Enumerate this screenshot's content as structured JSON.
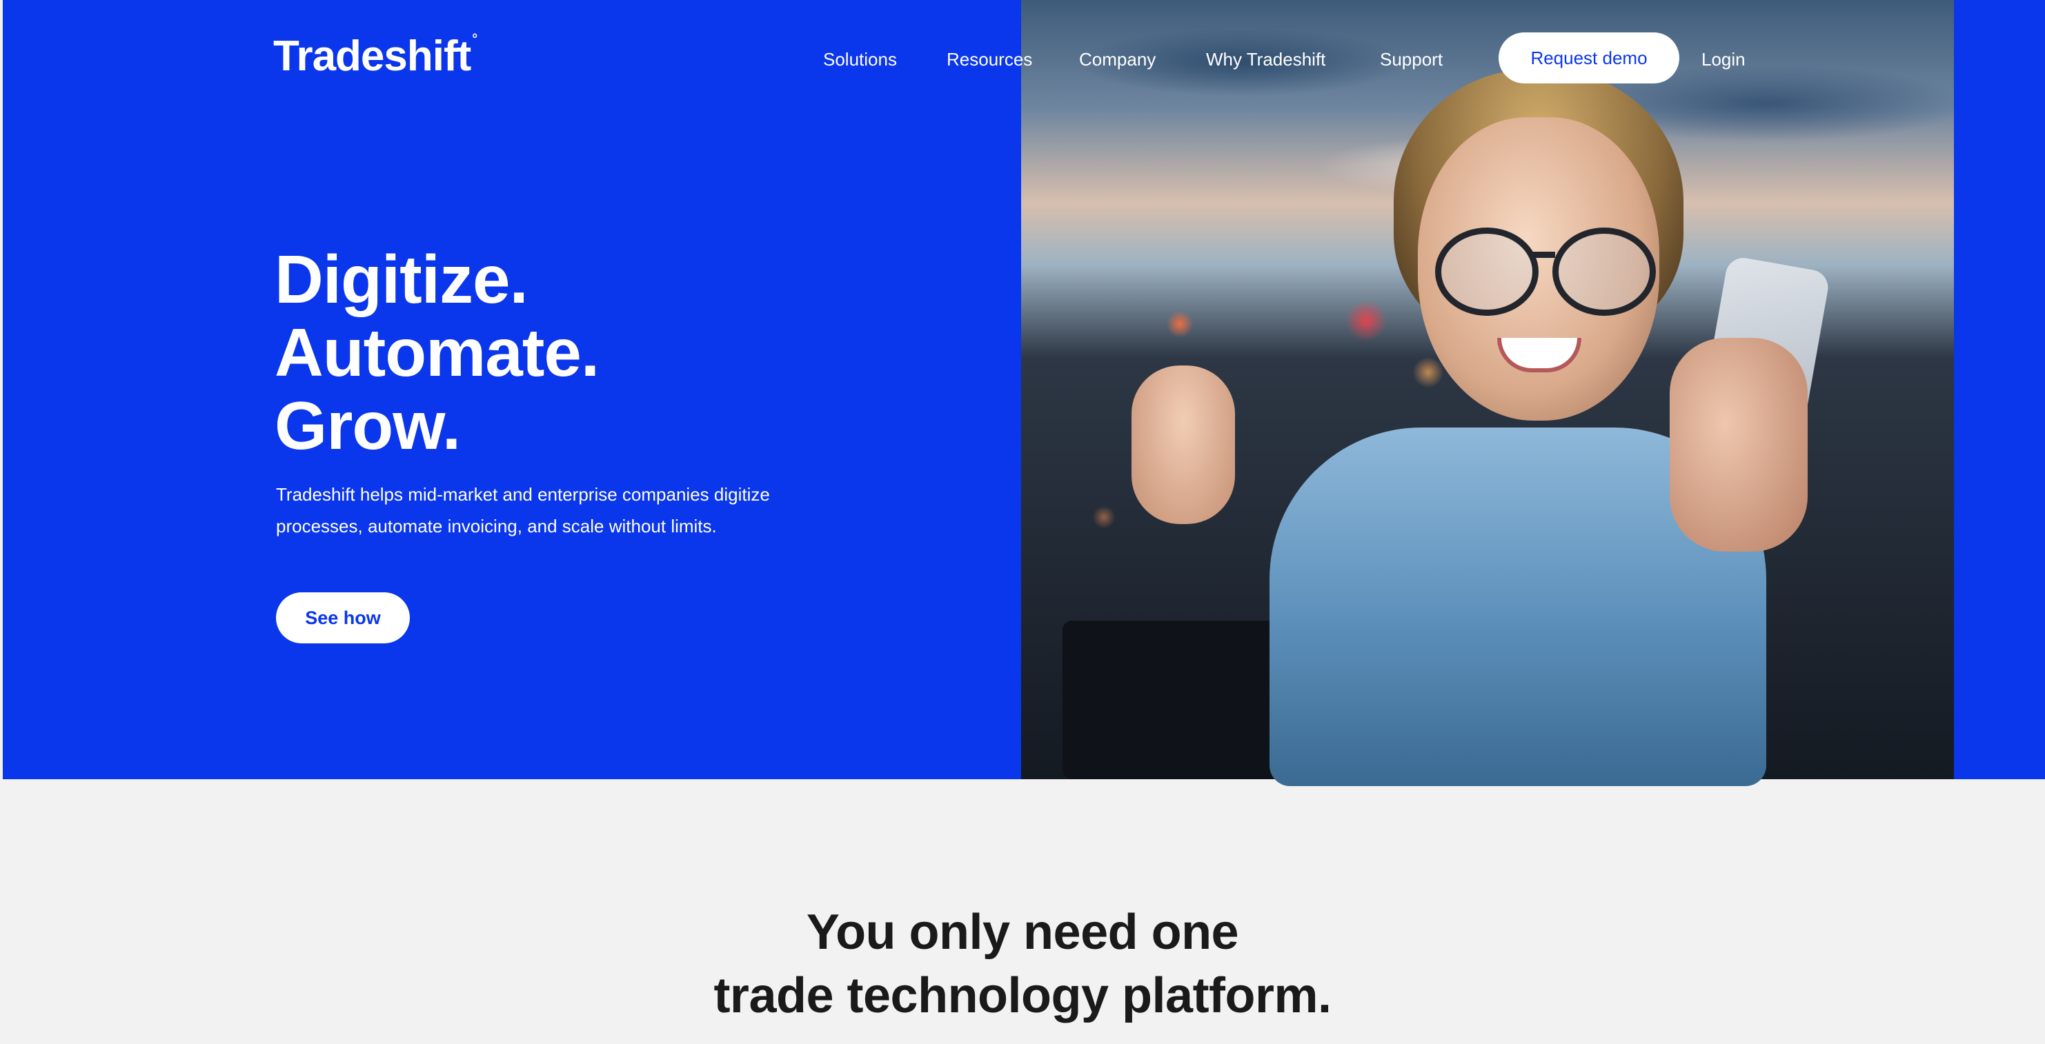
{
  "brand": {
    "name": "Tradeshift",
    "mark": "°"
  },
  "nav": {
    "items": [
      "Solutions",
      "Resources",
      "Company",
      "Why Tradeshift",
      "Support"
    ],
    "cta": "Request demo",
    "login": "Login"
  },
  "hero": {
    "headline": [
      "Digitize.",
      "Automate.",
      "Grow."
    ],
    "subtext": "Tradeshift helps mid-market and enterprise companies digitize processes, automate invoicing, and scale without limits.",
    "cta": "See how",
    "image_alt": "woman-with-glasses-smiling-at-phone"
  },
  "section": {
    "title_lines": [
      "You only need one",
      "trade technology platform."
    ]
  },
  "colors": {
    "brand_blue": "#0a36ec",
    "page_bg": "#f2f2f2",
    "text_dark": "#1a1a1a",
    "white": "#ffffff"
  }
}
